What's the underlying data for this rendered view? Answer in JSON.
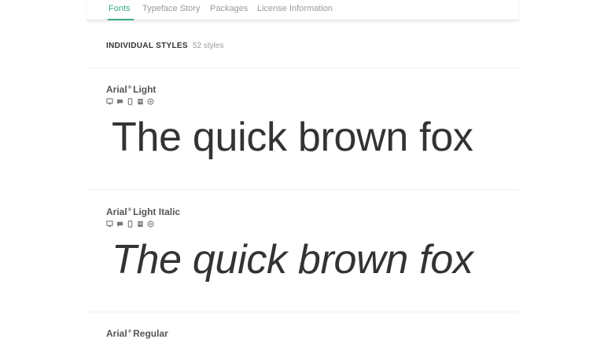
{
  "tabs": [
    {
      "label": "Fonts",
      "active": true
    },
    {
      "label": "Typeface Story",
      "active": false
    },
    {
      "label": "Packages",
      "active": false
    },
    {
      "label": "License Information",
      "active": false
    }
  ],
  "section": {
    "title": "INDIVIDUAL STYLES",
    "count": "52 styles"
  },
  "styles": [
    {
      "name": "Arial",
      "mark": "®",
      "weight": "Light",
      "sample": "The quick brown fox",
      "icons": [
        "desktop-icon",
        "chat-icon",
        "mobile-icon",
        "document-icon",
        "web-icon"
      ]
    },
    {
      "name": "Arial",
      "mark": "®",
      "weight": "Light Italic",
      "sample": "The quick brown fox",
      "icons": [
        "desktop-icon",
        "chat-icon",
        "mobile-icon",
        "document-icon",
        "web-icon"
      ]
    },
    {
      "name": "Arial",
      "mark": "®",
      "weight": "Regular",
      "sample": "",
      "icons": []
    }
  ],
  "colors": {
    "accent": "#3aa98d",
    "muted": "#9a9a9a",
    "text": "#333333"
  }
}
